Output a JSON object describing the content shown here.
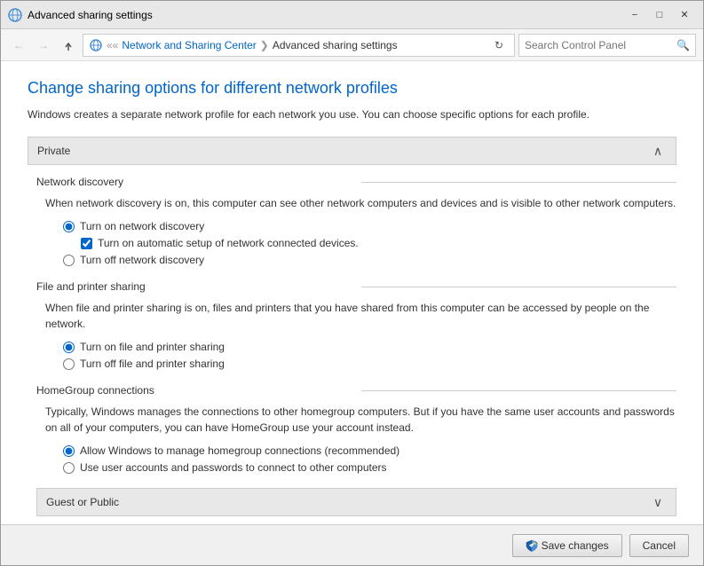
{
  "window": {
    "title": "Advanced sharing settings",
    "title_bar_icon": "🌐"
  },
  "nav": {
    "back_label": "←",
    "forward_label": "→",
    "up_label": "↑",
    "address_parts": [
      "Network and Sharing Center",
      "Advanced sharing settings"
    ],
    "search_placeholder": "Search Control Panel",
    "refresh_label": "↻"
  },
  "page": {
    "title": "Change sharing options for different network profiles",
    "description": "Windows creates a separate network profile for each network you use. You can choose specific options for each profile."
  },
  "private_section": {
    "header": "Private",
    "collapse_label": "∧",
    "network_discovery": {
      "title": "Network discovery",
      "description": "When network discovery is on, this computer can see other network computers and devices and is visible to other network computers.",
      "options": [
        {
          "id": "nd_on",
          "label": "Turn on network discovery",
          "checked": true
        },
        {
          "id": "nd_off",
          "label": "Turn off network discovery",
          "checked": false
        }
      ],
      "checkbox": {
        "label": "Turn on automatic setup of network connected devices.",
        "checked": true
      }
    },
    "file_printer": {
      "title": "File and printer sharing",
      "description": "When file and printer sharing is on, files and printers that you have shared from this computer can be accessed by people on the network.",
      "options": [
        {
          "id": "fp_on",
          "label": "Turn on file and printer sharing",
          "checked": true
        },
        {
          "id": "fp_off",
          "label": "Turn off file and printer sharing",
          "checked": false
        }
      ]
    },
    "homegroup": {
      "title": "HomeGroup connections",
      "description": "Typically, Windows manages the connections to other homegroup computers. But if you have the same user accounts and passwords on all of your computers, you can have HomeGroup use your account instead.",
      "options": [
        {
          "id": "hg_win",
          "label": "Allow Windows to manage homegroup connections (recommended)",
          "checked": true
        },
        {
          "id": "hg_user",
          "label": "Use user accounts and passwords to connect to other computers",
          "checked": false
        }
      ]
    }
  },
  "footer": {
    "save_label": "Save changes",
    "cancel_label": "Cancel"
  }
}
